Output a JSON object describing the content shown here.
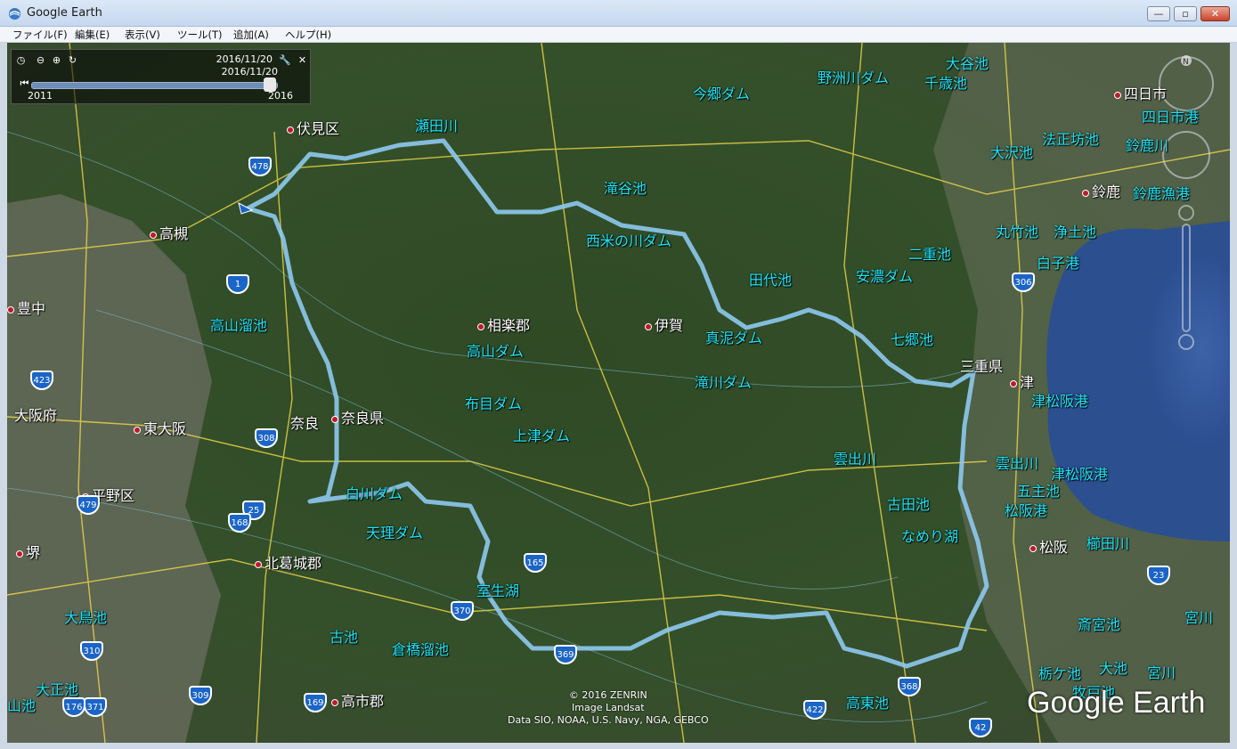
{
  "window": {
    "title": "Google Earth"
  },
  "menu": [
    "ファイル(F)",
    "編集(E)",
    "表示(V)",
    "ツール(T)",
    "追加(A)",
    "ヘルプ(H)"
  ],
  "time_slider": {
    "start_date": "2016/11/20",
    "end_date": "2016/11/20",
    "start_year": "2011",
    "end_year": "2016"
  },
  "map_labels": {
    "water": [
      "野洲川ダム",
      "大谷池",
      "千歳池",
      "今郷ダム",
      "瀬田川",
      "法正坊池",
      "鈴鹿川",
      "大沢池",
      "四日市港",
      "滝谷池",
      "鈴鹿漁港",
      "西米の川ダム",
      "丸竹池",
      "浄土池",
      "二重池",
      "白子港",
      "田代池",
      "安濃ダム",
      "高山溜池",
      "高山ダム",
      "真泥ダム",
      "七郷池",
      "滝川ダム",
      "布目ダム",
      "津松阪港",
      "上津ダム",
      "雲出川",
      "雲出川",
      "津松阪港",
      "白川ダム",
      "古田池",
      "五主池",
      "松阪港",
      "天理ダム",
      "なめり湖",
      "櫛田川",
      "室生湖",
      "大鳥池",
      "斎宮池",
      "宮川",
      "古池",
      "倉橋溜池",
      "大正池",
      "栃ケ池",
      "大池",
      "宮川",
      "牧戸池",
      "高東池",
      "山池"
    ],
    "cities": [
      "伏見区",
      "四日市",
      "鈴鹿",
      "高槻",
      "豊中",
      "相楽郡",
      "伊賀",
      "三重県",
      "津",
      "大阪府",
      "東大阪",
      "奈良",
      "奈良県",
      "平野区",
      "堺",
      "北葛城郡",
      "松阪",
      "高市郡"
    ]
  },
  "shields": [
    "478",
    "1",
    "423",
    "308",
    "479",
    "25",
    "168",
    "165",
    "370",
    "369",
    "306",
    "23",
    "310",
    "176",
    "371",
    "309",
    "169",
    "422",
    "368",
    "42"
  ],
  "copyright": [
    "© 2016 ZENRIN",
    "Image Landsat",
    "Data SIO, NOAA, U.S. Navy, NGA, GEBCO"
  ],
  "logo": "Google Earth"
}
